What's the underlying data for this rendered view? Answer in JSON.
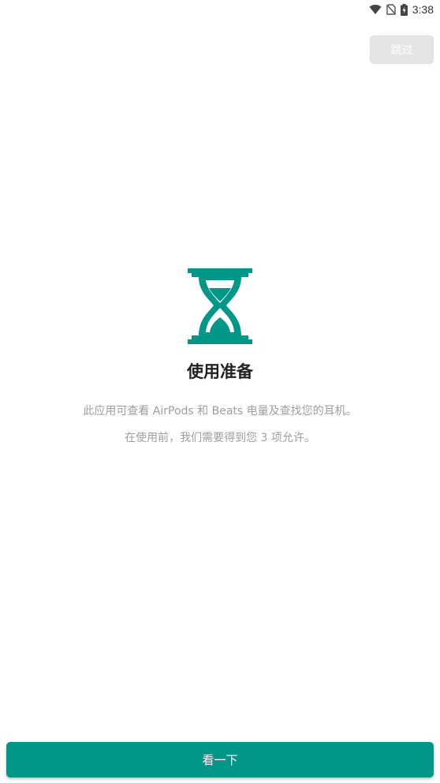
{
  "status_bar": {
    "time": "3:38",
    "icons": [
      "wifi-icon",
      "no-sim-icon",
      "battery-charging-icon"
    ]
  },
  "header": {
    "skip_label": "跳过"
  },
  "main": {
    "icon": "hourglass-icon",
    "title": "使用准备",
    "description_line1": "此应用可查看 AirPods 和 Beats 电量及查找您的耳机。",
    "description_line2": "在使用前，我们需要得到您 3 项允许。"
  },
  "footer": {
    "primary_label": "看一下"
  },
  "colors": {
    "accent": "#009688",
    "skip_bg": "#e5e5e5",
    "title": "#212121",
    "description": "#9e9e9e"
  }
}
